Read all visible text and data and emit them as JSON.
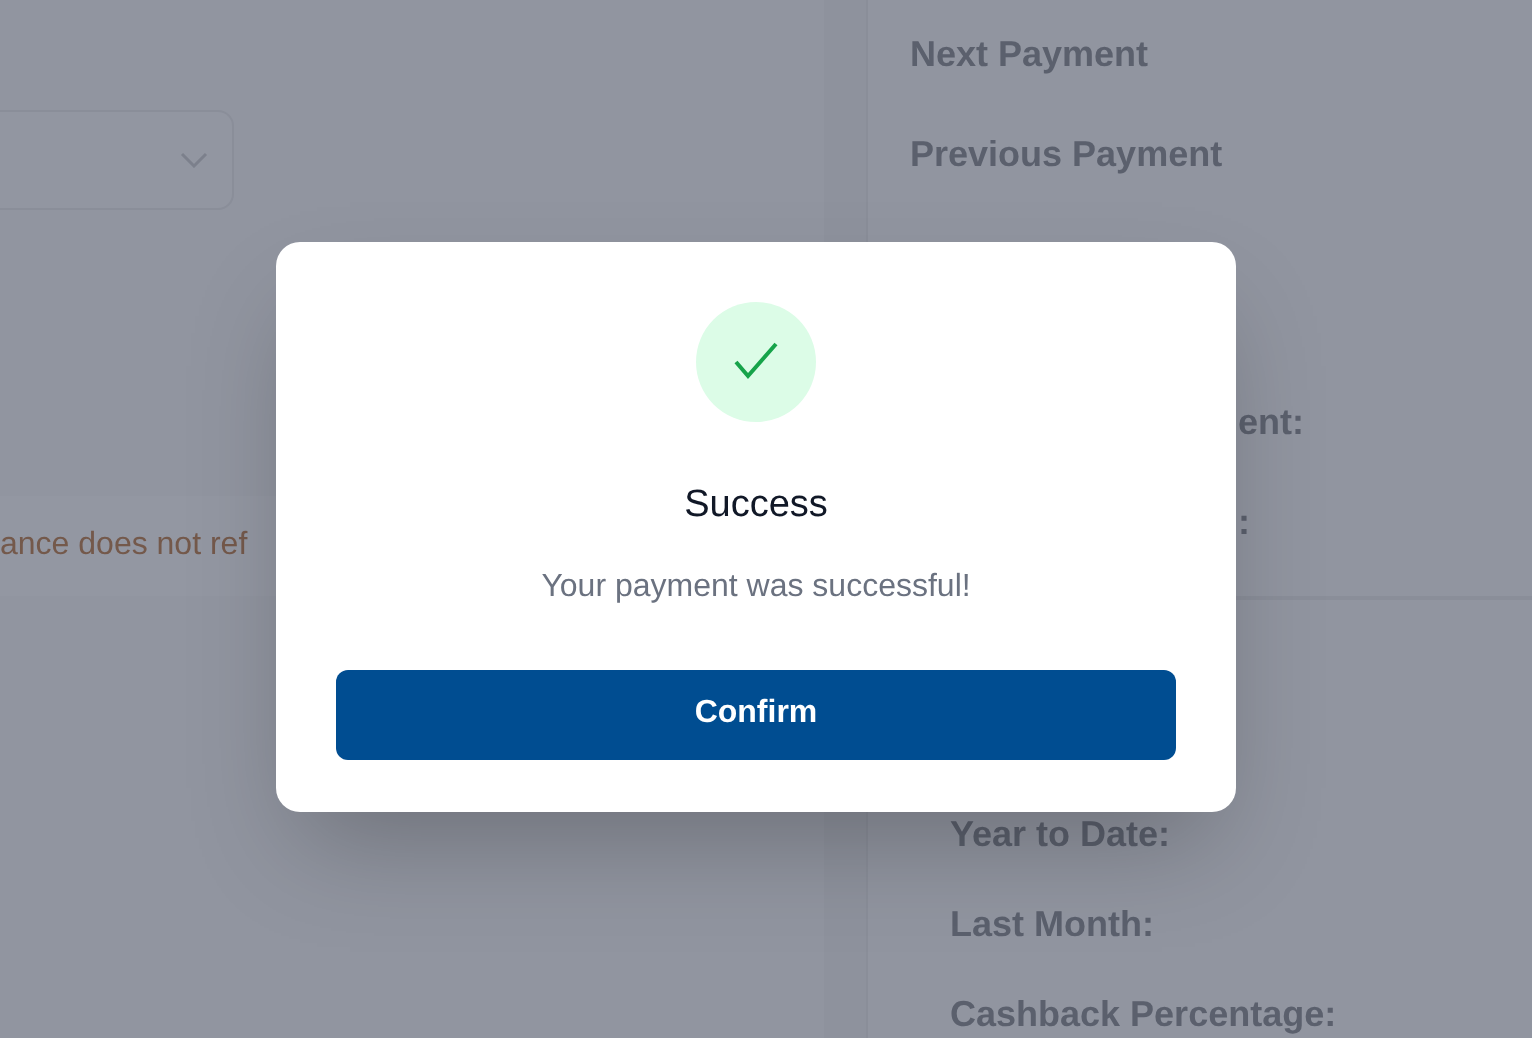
{
  "background": {
    "notice": "ance does not ref",
    "payments": [
      "Next Payment",
      "Previous Payment"
    ],
    "covered_labels": [
      "ent:",
      ":"
    ],
    "cashback": [
      "Year to Date:",
      "Last Month:",
      "Cashback Percentage:"
    ]
  },
  "dialog": {
    "title": "Success",
    "message": "Your payment was successful!",
    "button": "Confirm"
  }
}
